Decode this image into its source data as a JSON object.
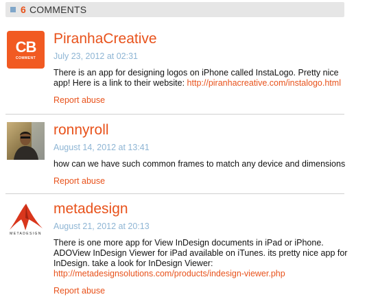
{
  "header": {
    "count": "6",
    "label": "COMMENTS"
  },
  "comments": [
    {
      "author": "PiranhaCreative",
      "date": "July 23, 2012 at 02:31",
      "text": "There is an app for designing logos on iPhone called InstaLogo. Pretty nice app! Here is a link to their website: ",
      "link": "http://piranhacreative.com/instalogo.html",
      "report": "Report abuse",
      "avatar": {
        "type": "logo",
        "big": "CB",
        "small": "COMMENT",
        "color": "#f15a22"
      }
    },
    {
      "author": "ronnyroll",
      "date": "August 14, 2012 at 13:41",
      "text": "how can we have such common frames to match any device and dimensions",
      "link": "",
      "report": "Report abuse",
      "avatar": {
        "type": "photo"
      }
    },
    {
      "author": "metadesign",
      "date": "August 21, 2012 at 20:13",
      "text": "There is one more app for View InDesign documents in iPad or iPhone. ADOView InDesign Viewer for iPad available on iTunes. its pretty nice app for InDesign. take a look for InDesign Viewer: ",
      "link": "http://metadesignsolutions.com/products/indesign-viewer.php",
      "report": "Report abuse",
      "avatar": {
        "type": "logo",
        "small": "METADESIGN",
        "color": "#d9361c"
      }
    }
  ]
}
